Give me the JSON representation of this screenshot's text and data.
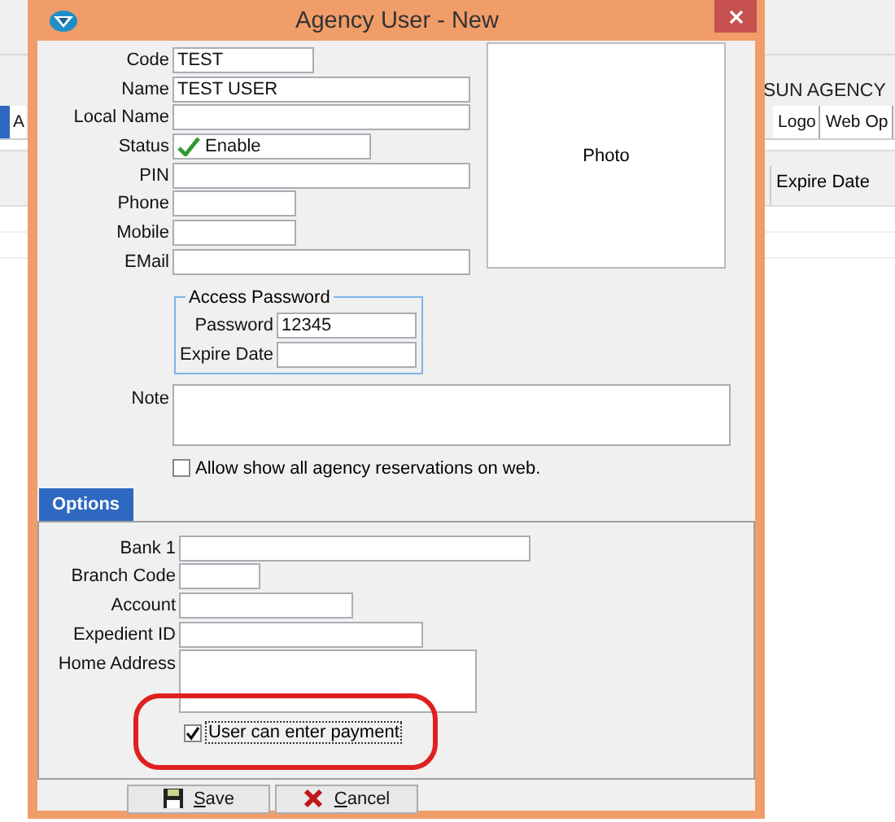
{
  "background_app": {
    "heading": "SUN AGENCY",
    "tabs": [
      {
        "selected": true
      },
      {
        "label": "A",
        "selected": false
      },
      {
        "label": "Logo",
        "selected": false
      },
      {
        "label": "Web Op",
        "selected": false
      }
    ],
    "column_header": "Expire Date"
  },
  "window": {
    "title": "Agency User - New",
    "fields": [
      {
        "label": "Code",
        "kind": "text",
        "value": "TEST"
      },
      {
        "label": "Name",
        "kind": "text",
        "value": "TEST USER"
      },
      {
        "label": "Local Name",
        "kind": "text"
      },
      {
        "label": "Status",
        "kind": "status",
        "value": "Enable"
      },
      {
        "label": "PIN",
        "kind": "text"
      },
      {
        "label": "Phone",
        "kind": "text"
      },
      {
        "label": "Mobile",
        "kind": "text"
      },
      {
        "label": "EMail",
        "kind": "text"
      }
    ],
    "photo_label": "Photo",
    "access_password": {
      "title": "Access Password",
      "fields": [
        {
          "label": "Password",
          "value": "12345"
        },
        {
          "label": "Expire Date"
        }
      ]
    },
    "note_label": "Note",
    "allow_web": {
      "label": "Allow show all agency reservations on web.",
      "checked": false
    },
    "tabs": [
      {
        "label": "Options",
        "selected": true
      }
    ],
    "options_fields": [
      {
        "label": "Bank 1",
        "kind": "text"
      },
      {
        "label": "Branch Code",
        "kind": "text"
      },
      {
        "label": "Account",
        "kind": "text"
      },
      {
        "label": "Expedient ID",
        "kind": "text"
      },
      {
        "label": "Home Address",
        "kind": "textarea"
      }
    ],
    "payment": {
      "label": "User can enter payment",
      "checked": true,
      "focused": true,
      "highlighted": true
    },
    "buttons": [
      {
        "label": "Save",
        "kind": "save"
      },
      {
        "label": "Cancel",
        "kind": "cancel"
      }
    ]
  }
}
